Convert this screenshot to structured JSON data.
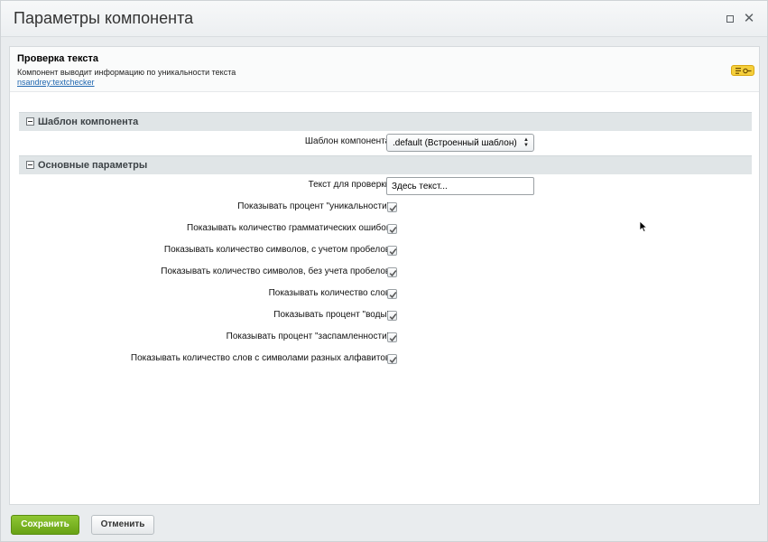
{
  "dialog": {
    "title": "Параметры компонента",
    "maximize_icon": "maximize-icon",
    "close_icon": "close-icon"
  },
  "component": {
    "name": "Проверка текста",
    "description": "Компонент выводит информацию по уникальности текста",
    "code": "nsandrey:textchecker",
    "help_icon": "help-list-icon"
  },
  "sections": {
    "template": {
      "title": "Шаблон компонента",
      "field_label": "Шаблон компонента:",
      "selected": ".default (Встроенный шаблон)"
    },
    "main": {
      "title": "Основные параметры",
      "text_label": "Текст для проверки:",
      "text_value": "Здесь текст...",
      "checkboxes": [
        {
          "label": "Показывать процент \"уникальности\":",
          "checked": true
        },
        {
          "label": "Показывать количество грамматических ошибок:",
          "checked": true
        },
        {
          "label": "Показывать количество символов, с учетом пробелов:",
          "checked": true
        },
        {
          "label": "Показывать количество символов, без учета пробелов:",
          "checked": true
        },
        {
          "label": "Показывать количество слов:",
          "checked": true
        },
        {
          "label": "Показывать процент \"воды\":",
          "checked": true
        },
        {
          "label": "Показывать процент \"заспамленности\":",
          "checked": true
        },
        {
          "label": "Показывать количество слов с символами разных алфавитов:",
          "checked": true
        }
      ]
    }
  },
  "footer": {
    "save_label": "Сохранить",
    "cancel_label": "Отменить"
  },
  "colors": {
    "save_button": "#79b222",
    "section_header": "#e0e5e7",
    "link": "#2067b0",
    "help_badge": "#f5cf3b"
  }
}
